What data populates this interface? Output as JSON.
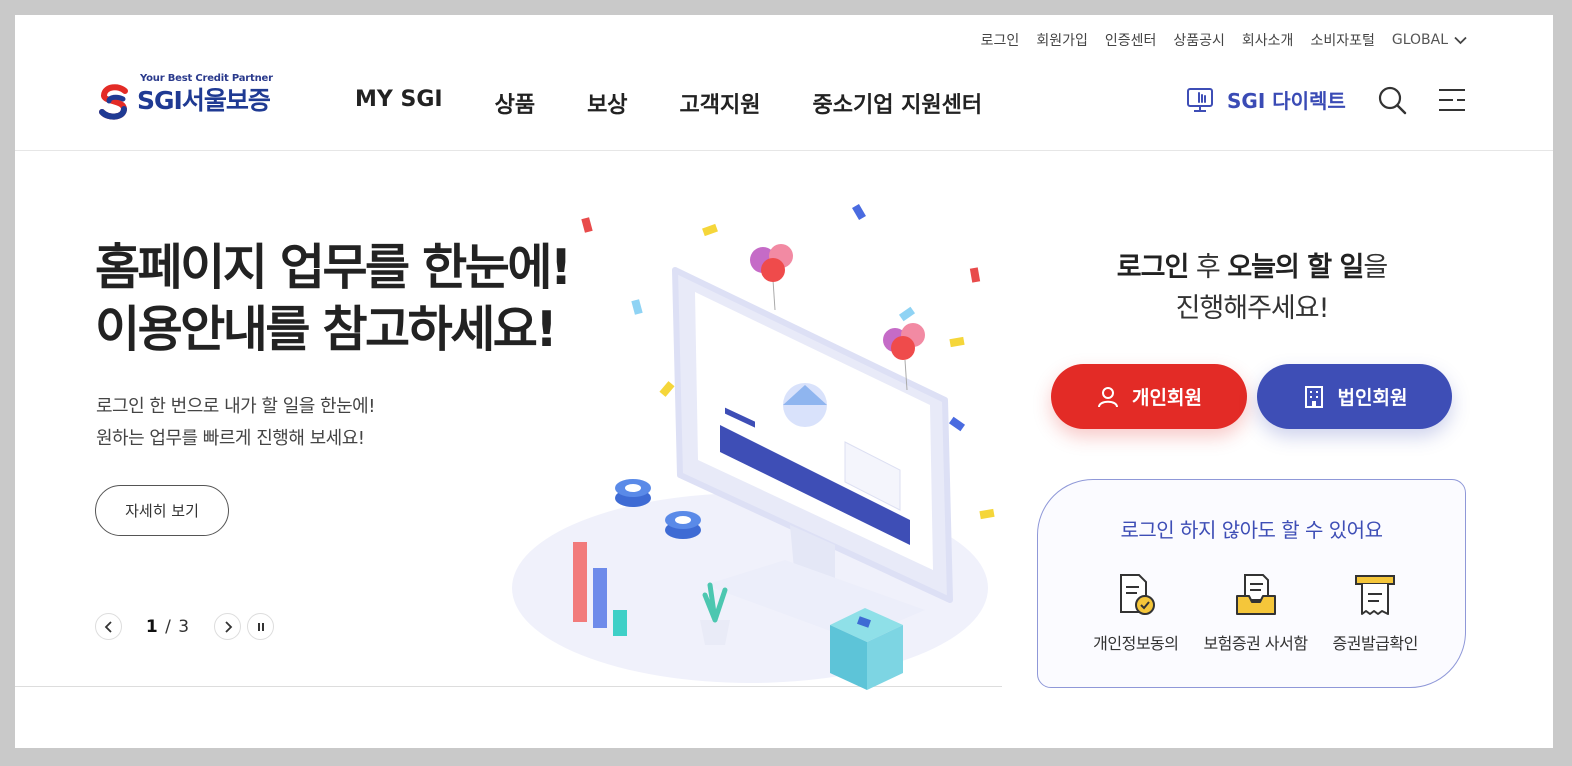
{
  "utility_nav": [
    "로그인",
    "회원가입",
    "인증센터",
    "상품공시",
    "회사소개",
    "소비자포털",
    "GLOBAL"
  ],
  "logo": {
    "tagline": "Your Best Credit Partner",
    "name": "SGI서울보증"
  },
  "gnb": [
    "MY SGI",
    "상품",
    "보상",
    "고객지원",
    "중소기업 지원센터"
  ],
  "direct": {
    "label": "SGI 다이렉트"
  },
  "hero": {
    "title_line1": "홈페이지 업무를 한눈에!",
    "title_line2": "이용안내를 참고하세요!",
    "desc_line1": "로그인 한 번으로 내가 할 일을 한눈에!",
    "desc_line2": "원하는 업무를 빠르게 진행해 보세요!",
    "detail_button": "자세히 보기",
    "pager": {
      "current": "1",
      "separator": "/",
      "total": "3"
    }
  },
  "login_panel": {
    "msg_hl1": "로그인",
    "msg_mid": " 후 ",
    "msg_hl2": "오늘의 할 일",
    "msg_end": "을",
    "msg_line2": "진행해주세요!",
    "personal_button": "개인회원",
    "corporate_button": "법인회원"
  },
  "quick_box": {
    "title": "로그인 하지 않아도 할 수 있어요",
    "items": [
      "개인정보동의",
      "보험증권 사서함",
      "증권발급확인"
    ]
  },
  "colors": {
    "brand_red": "#e32b26",
    "brand_blue": "#3e4eb6",
    "logo_blue": "#1f3a93"
  }
}
